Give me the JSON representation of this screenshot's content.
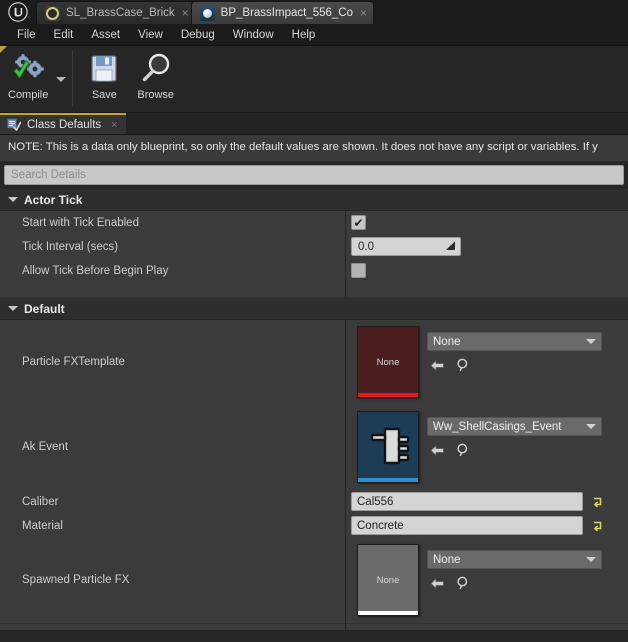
{
  "window": {
    "logo": "unreal-engine-logo",
    "tabs": [
      {
        "label": "SL_BrassCase_Brick",
        "icon": "static-mesh-icon",
        "active": false,
        "close": "×"
      },
      {
        "label": "BP_BrassImpact_556_Co",
        "icon": "blueprint-icon",
        "active": true,
        "close": "×"
      }
    ]
  },
  "menubar": {
    "items": [
      "File",
      "Edit",
      "Asset",
      "View",
      "Debug",
      "Window",
      "Help"
    ]
  },
  "toolbar": {
    "compile_label": "Compile",
    "compile_icon": "compile-gears-check-icon",
    "compile_dropdown_icon": "chevron-down-icon",
    "save_label": "Save",
    "save_icon": "floppy-disk-icon",
    "browse_label": "Browse",
    "browse_icon": "magnifier-icon"
  },
  "subtabs": [
    {
      "label": "Class Defaults",
      "icon": "class-defaults-icon",
      "close": "×",
      "active": true
    }
  ],
  "note": {
    "text": "NOTE: This is a data only blueprint, so only the default values are shown.  It does not have any script or variables.  If y"
  },
  "search": {
    "placeholder": "Search Details",
    "value": ""
  },
  "details": {
    "categories": [
      {
        "title": "Actor Tick",
        "expanded": true,
        "collapse_icon": "triangle-down-icon",
        "rows": [
          {
            "name": "Start with Tick Enabled",
            "widget": "checkbox",
            "checked": true,
            "check_glyph": "✔"
          },
          {
            "name": "Tick Interval (secs)",
            "widget": "number",
            "value": "0.0",
            "spinner_icon": "spinner-drag-icon"
          },
          {
            "name": "Allow Tick Before Begin Play",
            "widget": "checkbox",
            "checked": false,
            "check_glyph": ""
          }
        ]
      },
      {
        "title": "Default",
        "expanded": true,
        "collapse_icon": "triangle-down-icon",
        "rows": [
          {
            "name": "Particle FXTemplate",
            "widget": "asset",
            "thumb_label": "None",
            "thumb_color": "red",
            "thumb_accent": "#e01b1b",
            "combo_value": "None",
            "combo_icon": "chevron-down-icon",
            "browse_icon": "arrow-left-icon",
            "find_icon": "magnifier-icon"
          },
          {
            "name": "Ak Event",
            "widget": "asset",
            "thumb_label": "",
            "thumb_color": "blue",
            "thumb_accent": "#2b8fd4",
            "thumb_icon": "wwise-ak-event-icon",
            "combo_value": "Ww_ShellCasings_Event",
            "combo_icon": "chevron-down-icon",
            "browse_icon": "arrow-left-icon",
            "find_icon": "magnifier-icon"
          },
          {
            "name": "Caliber",
            "widget": "text",
            "value": "Cal556",
            "reset_icon": "reset-to-default-icon"
          },
          {
            "name": "Material",
            "widget": "text",
            "value": "Concrete",
            "reset_icon": "reset-to-default-icon"
          },
          {
            "name": "Spawned Particle FX",
            "widget": "asset",
            "thumb_label": "None",
            "thumb_color": "grey",
            "thumb_accent": "#ffffff",
            "combo_value": "None",
            "combo_icon": "chevron-down-icon",
            "browse_icon": "arrow-left-icon",
            "find_icon": "magnifier-icon"
          }
        ]
      }
    ]
  },
  "colors": {
    "accent_gold": "#c8a02a",
    "panel_bg": "#3b3b3b",
    "header_bg": "#2e2e2e",
    "chrome_bg": "#262626",
    "field_bg": "#d4d4d4",
    "combo_bg": "#6a6a6a",
    "reset_yellow": "#d8d84a"
  }
}
